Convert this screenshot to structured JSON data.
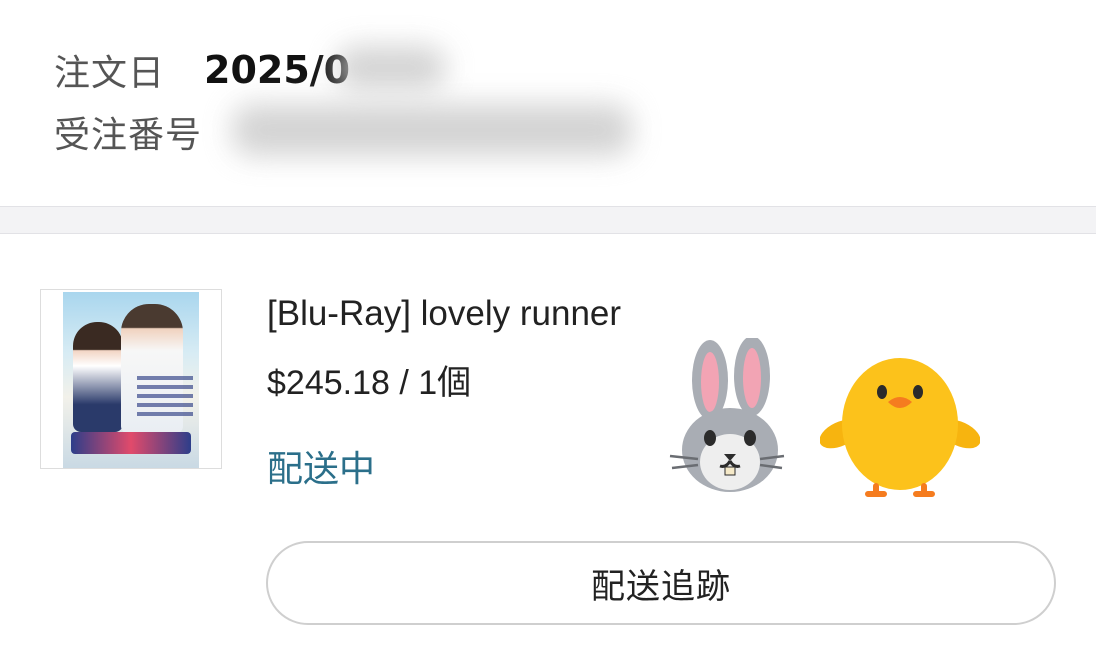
{
  "order": {
    "date_label": "注文日",
    "date_value": "2025/0",
    "number_label": "受注番号"
  },
  "item": {
    "name": "[Blu-Ray] lovely runner",
    "price_qty": "$245.18 / 1個",
    "status": "配送中",
    "status_color": "#2b6f8a"
  },
  "actions": {
    "track_label": "配送追跡"
  },
  "stickers": [
    "rabbit-face-icon",
    "chick-icon"
  ]
}
